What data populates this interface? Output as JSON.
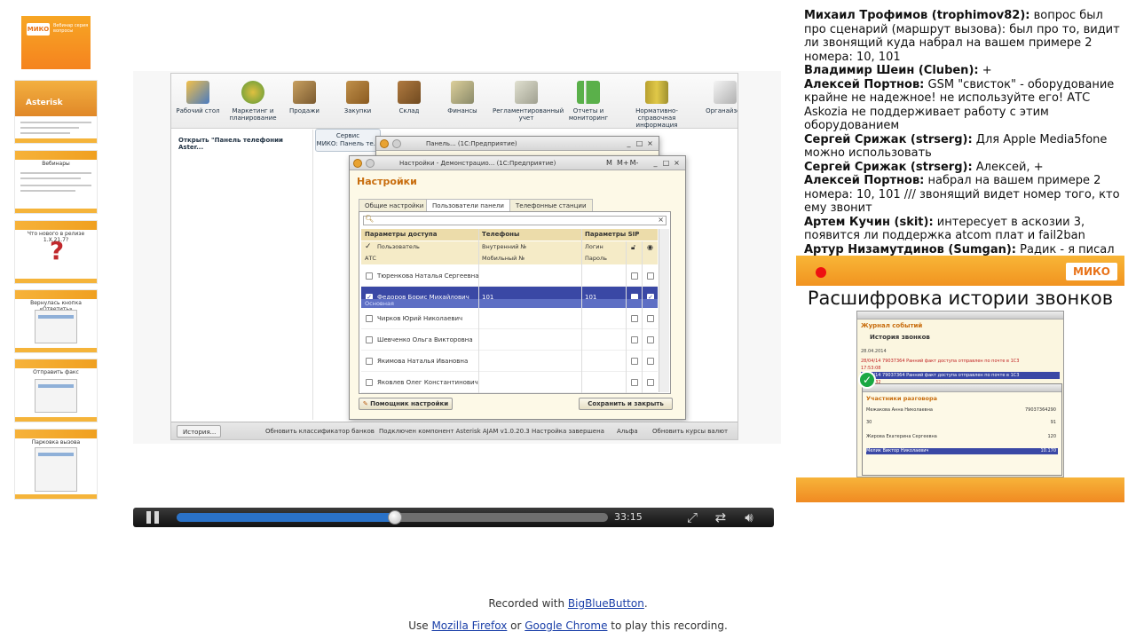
{
  "thumbnails": {
    "logo": {
      "mark": "МИКО",
      "text": "Вебинар серия вопросы"
    },
    "items": [
      {
        "title": "Asterisk"
      },
      {
        "title": "Вебинары"
      },
      {
        "title": "Что нового в релизе 1.Х.21.7?"
      },
      {
        "title": "Вернулась кнопка «Ответить»"
      },
      {
        "title": "Отправить факс"
      },
      {
        "title": "Парковка вызова"
      }
    ]
  },
  "video": {
    "toolbar": [
      "Рабочий стол",
      "Маркетинг и планирование",
      "Продажи",
      "Закупки",
      "Склад",
      "Финансы",
      "Регламентированный учет",
      "Отчеты и мониторинг",
      "Нормативно-справочная информация",
      "Органайзер"
    ],
    "left_header": "Открыть \"Панель телефонии Aster...",
    "service_tab": "Сервис",
    "panel_tab": "МИКО: Панель те...",
    "win1_title": "Панель... (1С:Предприятие)",
    "win2_title": "Настройки - Демонстрацио... (1С:Предприятие)",
    "win2_controls": [
      "M",
      "M+",
      "M-",
      "_",
      "□",
      "×"
    ],
    "settings_title": "Настройки",
    "tabs": [
      "Общие настройки",
      "Пользователи панели",
      "Телефонные станции"
    ],
    "columns": [
      "Параметры доступа",
      "Телефоны",
      "Параметры SIP"
    ],
    "sub_header1": [
      "Пользователь",
      "Внутренний №",
      "Логин"
    ],
    "sub_header2": [
      "АТС",
      "Мобильный №",
      "Пароль"
    ],
    "rows": [
      {
        "name": "Тюренкова Наталья Сергеевна",
        "phone": "",
        "sip": ""
      },
      {
        "name": "Федоров Борис Михайлович",
        "phone": "101",
        "sip": "101",
        "sub": "Основная"
      },
      {
        "name": "Чирков Юрий Николаевич",
        "phone": "",
        "sip": ""
      },
      {
        "name": "Шевченко Ольга Викторовна",
        "phone": "",
        "sip": ""
      },
      {
        "name": "Якимова Наталья Ивановна",
        "phone": "",
        "sip": ""
      },
      {
        "name": "Яковлев Олег Константинович",
        "phone": "",
        "sip": ""
      }
    ],
    "helper_button": "Помощник настройки",
    "save_button": "Сохранить и закрыть",
    "taskbar": [
      "История...",
      "Обновить классификатор банков",
      "Подключен компонент Asterisk AJAM v1.0.20.3",
      "Настройка завершена",
      "Альфа",
      "Обновить курсы валют"
    ]
  },
  "player": {
    "time": "33:15",
    "progress": 0.506
  },
  "chat": [
    {
      "author": "Михаил Трофимов (trophimov82):",
      "text": "вопрос был про сценарий (маршрут вызова): был про то, видит ли звонящий куда набрал на вашем примере 2 номера: 10, 101"
    },
    {
      "author": "Владимир Шеин (Cluben):",
      "text": "+"
    },
    {
      "author": "Алексей Портнов:",
      "text": "GSM \"свисток\" - оборудование крайне не надежное! не используйте его! АТС Askozia не поддерживает работу с этим оборудованием"
    },
    {
      "author": "Сергей Срижак (strserg):",
      "text": "Для Apple Media5fone можно использовать"
    },
    {
      "author": "Сергей Срижак (strserg):",
      "text": "Алексей, +"
    },
    {
      "author": "Алексей Портнов:",
      "text": "набрал на вашем примере 2 номера: 10, 101 /// звонящий видет номер того, кто ему звонит"
    },
    {
      "author": "Артем Кучин (skit):",
      "text": "интересует в аскозии 3, появится ли поддержка atcom плат и fail2ban"
    },
    {
      "author": "Артур Низамутдинов (Sumgan):",
      "text": "Радик - я писал про свистки"
    }
  ],
  "slide": {
    "logo": "МИКО",
    "title": "Расшифровка истории звонков",
    "journal": "Журнал событий",
    "history": "История звонков",
    "date": "28.04.2014",
    "calls": [
      {
        "text": "28/04/14  79037364  Ранний факт доступа отправлен по почте в 1С3"
      },
      {
        "text": "17:53:08"
      },
      {
        "text": "28/04/14  79037364  Ранний факт доступа отправлен по почте в 1С3"
      },
      {
        "text": "17:52:32"
      }
    ],
    "participants_title": "Участники разговора",
    "participants": [
      {
        "name": "Межакова Анна Николаевна",
        "num": "79037364290"
      },
      {
        "name": "30",
        "num": "91"
      },
      {
        "name": "Жирова Екатерина Сергеевна",
        "num": "120"
      },
      {
        "name": "Мелик Виктор Николаевич",
        "num": "10.170"
      }
    ]
  },
  "footer": {
    "line1_pre": "Recorded with ",
    "line1_link": "BigBlueButton",
    "line1_post": ".",
    "line2_pre": "Use ",
    "line2_link1": "Mozilla Firefox",
    "line2_mid": " or ",
    "line2_link2": "Google Chrome",
    "line2_post": " to play this recording."
  }
}
